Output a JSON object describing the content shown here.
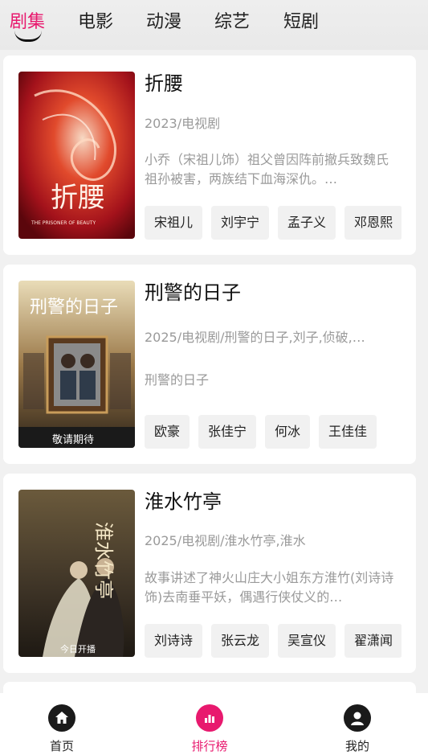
{
  "tabs": [
    {
      "label": "剧集",
      "active": true
    },
    {
      "label": "电影"
    },
    {
      "label": "动漫"
    },
    {
      "label": "综艺"
    },
    {
      "label": "短剧"
    }
  ],
  "cards": [
    {
      "title": "折腰",
      "meta": "2023/电视剧",
      "desc": "小乔（宋祖儿饰）祖父曾因阵前撤兵致魏氏祖孙被害，两族结下血海深仇。…",
      "tags": [
        "宋祖儿",
        "刘宇宁",
        "孟子义",
        "邓恩熙"
      ],
      "poster": {
        "text": "折腰",
        "sub": "THE PRISONER OF BEAUTY"
      }
    },
    {
      "title": "刑警的日子",
      "meta": "2025/电视剧/刑警的日子,刘子,侦破,…",
      "desc": "刑警的日子",
      "tags": [
        "欧豪",
        "张佳宁",
        "何冰",
        "王佳佳"
      ],
      "poster": {
        "text": "刑警的日子",
        "sub": "敬请期待"
      }
    },
    {
      "title": "淮水竹亭",
      "meta": "2025/电视剧/淮水竹亭,淮水",
      "desc": "故事讲述了神火山庄大小姐东方淮竹(刘诗诗 饰)去南垂平妖，偶遇行侠仗义的…",
      "tags": [
        "刘诗诗",
        "张云龙",
        "吴宣仪",
        "翟潇闻"
      ],
      "poster": {
        "text": "淮水竹亭",
        "sub": "今日开播"
      }
    }
  ],
  "bottom_nav": [
    {
      "label": "首页",
      "icon": "home-icon"
    },
    {
      "label": "排行榜",
      "icon": "ranking-chart-icon",
      "active": true
    },
    {
      "label": "我的",
      "icon": "user-profile-icon"
    }
  ],
  "colors": {
    "accent": "#e8196e",
    "text": "#222222",
    "muted": "#9a9a9a",
    "tag_bg": "#f1f1f1"
  }
}
